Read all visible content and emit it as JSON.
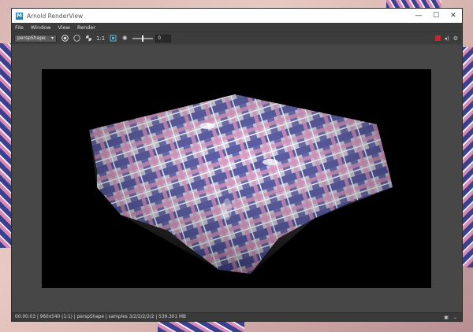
{
  "window": {
    "title": "Arnold RenderView",
    "app_icon_letter": "M"
  },
  "window_controls": {
    "minimize": "—",
    "maximize": "☐",
    "close": "✕"
  },
  "menu": {
    "items": [
      "File",
      "Window",
      "View",
      "Render"
    ]
  },
  "toolbar": {
    "camera_value": "perspShape",
    "ratio_label": "1:1",
    "exposure_value": "0",
    "exposure_level": 0.5
  },
  "status": {
    "text": "00:00:03 | 960x540 (1:1) | perspShape  | samples 3/2/2/2/2/2 | 539.301 MB"
  },
  "icons": {
    "app": "maya-icon",
    "render_region": "aov-icon",
    "stop": "stop-icon",
    "snapshot": "camera-icon"
  }
}
